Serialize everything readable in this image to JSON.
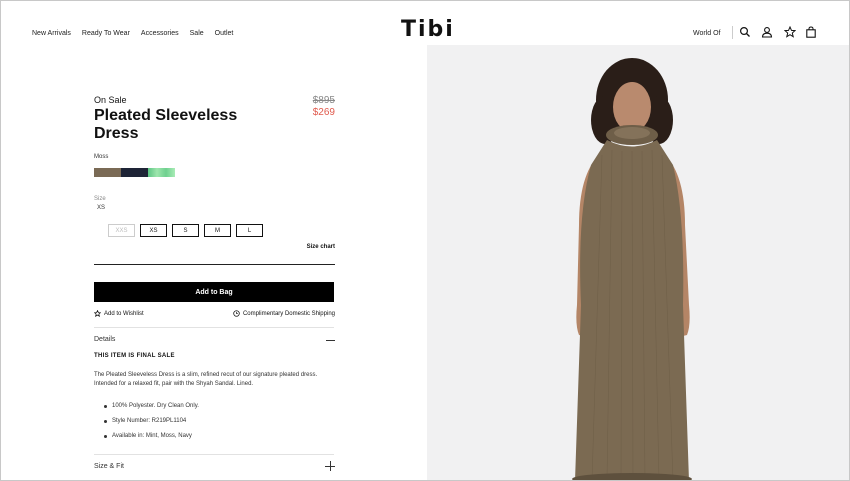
{
  "header": {
    "nav": [
      "New Arrivals",
      "Ready To Wear",
      "Accessories",
      "Sale",
      "Outlet"
    ],
    "logo": "Tibi",
    "world": "World Of",
    "icons": [
      "search-icon",
      "account-icon",
      "wishlist-star-icon",
      "bag-icon"
    ]
  },
  "product": {
    "badge": "On Sale",
    "name": "Pleated Sleeveless Dress",
    "price_original": "$895",
    "price_sale": "$269",
    "color_label": "Moss",
    "swatches": [
      {
        "name": "Moss",
        "color": "#7a6a55"
      },
      {
        "name": "Navy",
        "color": "#1e2436"
      },
      {
        "name": "Mint",
        "color": "#7fd49a"
      }
    ],
    "size_label": "Size",
    "size_selected": "XS",
    "sizes": [
      {
        "label": "XXS",
        "available": false
      },
      {
        "label": "XS",
        "available": true
      },
      {
        "label": "S",
        "available": true
      },
      {
        "label": "M",
        "available": true
      },
      {
        "label": "L",
        "available": true
      }
    ],
    "size_chart": "Size chart",
    "add_to_bag": "Add to Bag",
    "wishlist": "Add to Wishlist",
    "shipping": "Complimentary Domestic Shipping"
  },
  "details": {
    "label": "Details",
    "final_sale": "THIS ITEM IS FINAL SALE",
    "description": "The Pleated Sleeveless Dress is a slim, refined recut of our signature pleated dress. Intended for a relaxed fit, pair with the Shyah Sandal. Lined.",
    "bullets": [
      "100% Polyester. Dry Clean Only.",
      "Style Number: R219PL1104",
      "Available in: Mint, Moss, Navy"
    ]
  },
  "size_fit": {
    "label": "Size & Fit"
  },
  "colors": {
    "sale_red": "#e05a4d",
    "button_black": "#000000",
    "photo_bg": "#f1f1f2",
    "dress": "#7b6a52"
  }
}
